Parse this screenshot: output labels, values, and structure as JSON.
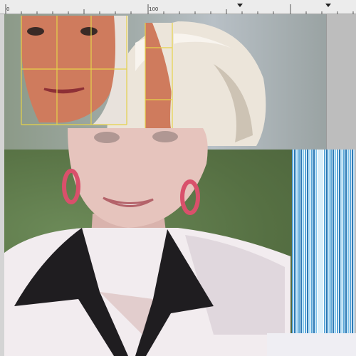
{
  "ruler": {
    "labels": [
      "0",
      "100"
    ]
  },
  "icons": {
    "ruler_marker": "triangle-marker",
    "grid_overlay": "yellow-grid-lines"
  },
  "colors": {
    "grid": "#e6d24a",
    "blazer": "#f4eef0",
    "collar": "#1d1b1d",
    "hair": "#ece6dc",
    "earring": "#d9506b",
    "barcode": "#5ba7d8"
  }
}
